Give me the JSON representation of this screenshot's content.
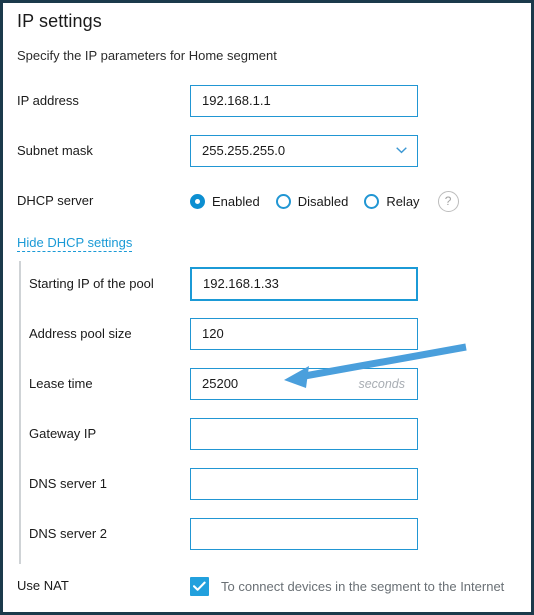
{
  "header": {
    "title": "IP settings",
    "subtitle": "Specify the IP parameters for Home segment"
  },
  "fields": {
    "ip_address": {
      "label": "IP address",
      "value": "192.168.1.1",
      "placeholder": ""
    },
    "subnet_mask": {
      "label": "Subnet mask",
      "value": "255.255.255.0",
      "chevron_icon": "chevron-down-icon"
    },
    "dhcp_server": {
      "label": "DHCP server",
      "options": [
        {
          "label": "Enabled",
          "selected": true
        },
        {
          "label": "Disabled",
          "selected": false
        },
        {
          "label": "Relay",
          "selected": false
        }
      ],
      "help_icon": "help-icon",
      "help_glyph": "?"
    },
    "toggle_link": {
      "label": "Hide DHCP settings"
    },
    "starting_ip": {
      "label": "Starting IP of the pool",
      "value": "192.168.1.33",
      "focused": true
    },
    "pool_size": {
      "label": "Address pool size",
      "value": "120"
    },
    "lease_time": {
      "label": "Lease time",
      "value": "25200",
      "suffix": "seconds"
    },
    "gateway_ip": {
      "label": "Gateway IP",
      "value": ""
    },
    "dns_server_1": {
      "label": "DNS server 1",
      "value": ""
    },
    "dns_server_2": {
      "label": "DNS server 2",
      "value": ""
    },
    "use_nat": {
      "label": "Use NAT",
      "checked": true,
      "description": "To connect devices in the segment to the Internet",
      "check_icon": "checkmark-icon"
    }
  },
  "annotation": {
    "name": "arrow-pointing-to-lease-time",
    "color": "#4a9fdc"
  },
  "colors": {
    "accent": "#1b9ad6",
    "field_border": "#2196d3",
    "checkbox_fill": "#22a0dd",
    "radio_selected": "#0d8fd1",
    "muted_text": "#6a7075",
    "placeholder_text": "#a8adb3",
    "frame_border": "#1b3a4b",
    "group_bar": "#cfd3d6"
  }
}
